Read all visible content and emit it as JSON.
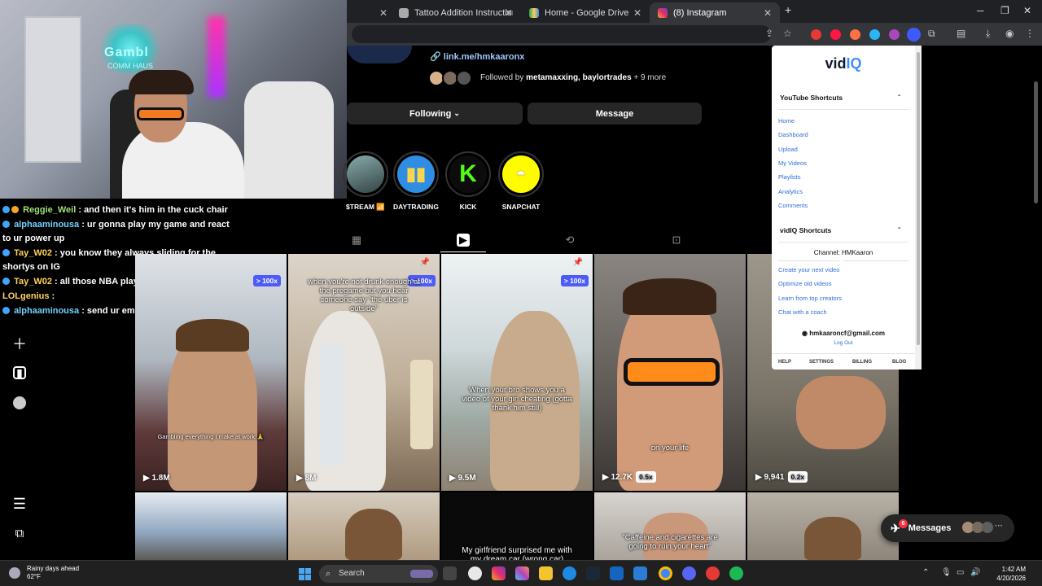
{
  "browser": {
    "tabs": [
      {
        "title": "Tattoo Addition Instructions",
        "active": false
      },
      {
        "title": "Home - Google Drive",
        "active": false
      },
      {
        "title": "(8) Instagram",
        "active": true
      }
    ],
    "new_tab_symbol": "+"
  },
  "webcam": {
    "sign_line1": "Gambl",
    "sign_line2": "COMM HAUS"
  },
  "chat": [
    {
      "user": "Reggie_Weil",
      "message": ": and then it's him in the cuck chair",
      "cont": ""
    },
    {
      "user": "alphaaminousa",
      "message": ": ur gonna play my game and react",
      "cont": "to ur power up"
    },
    {
      "user": "Tay_W02",
      "message": ": you know they always sliding for the",
      "cont": "shortys on IG"
    },
    {
      "user": "Tay_W02",
      "message": ": all those NBA players on that",
      "cont": ""
    },
    {
      "user": "LOLgenius",
      "message": ":",
      "cont": ""
    },
    {
      "user": "alphaaminousa",
      "message": ": send ur email",
      "cont": ""
    }
  ],
  "profile": {
    "link": "link.me/hmkaaronx",
    "followed_by_prefix": "Followed by ",
    "followed_by_names": "metamaxxing, baylortrades",
    "followed_by_more": " + 9 more",
    "following_button": "Following",
    "message_button": "Message"
  },
  "highlights": [
    {
      "label": "$TREAM 📶",
      "color": "#5a6a7a",
      "glyph": ""
    },
    {
      "label": "DAYTRADING",
      "color": "#2f8de4",
      "glyph": "📊"
    },
    {
      "label": "KICK",
      "color": "#0c0c0c",
      "glyph": "K"
    },
    {
      "label": "SNAPCHAT",
      "color": "#fffc00",
      "glyph": "👻"
    }
  ],
  "reels": [
    {
      "caption": "Gambling everything I make at work 🙏",
      "views": "1.8M",
      "multiplier": "> 100x",
      "bg": "#c9cdd3"
    },
    {
      "caption": "when you're not drunk enough at the pregame but you hear someone say \"the uber is outside\"",
      "views": "8M",
      "multiplier": "> 100x",
      "bg": "#b9a48f"
    },
    {
      "caption": "When your bro shows you a video of your girl cheating (gotta thank him still)",
      "views": "9.5M",
      "multiplier": "> 100x",
      "bg": "#c2ccd0"
    },
    {
      "caption": "on your life",
      "views": "12.7K",
      "multiplier": "0.5x",
      "bg": "#6e6a66"
    },
    {
      "caption": "",
      "views": "9,941",
      "multiplier": "0.2x",
      "bg": "#8c8a80"
    }
  ],
  "reels_row2": [
    {
      "caption": "",
      "bg": "#9ab0c8"
    },
    {
      "caption": "",
      "bg": "#b4a28e"
    },
    {
      "caption": "My girlfriend surprised me with my dream car (wrong car)",
      "bg": "#0a0a0a"
    },
    {
      "caption": "\"Caffeine and cigarettes are going to ruin your heart\"",
      "bg": "#c8c4c0"
    },
    {
      "caption": "",
      "bg": "#a29c94"
    }
  ],
  "vidiq": {
    "logo_a": "vid",
    "logo_b": "IQ",
    "youtube_section": "YouTube Shortcuts",
    "youtube_links": [
      "Home",
      "Dashboard",
      "Upload",
      "My Videos",
      "Playlists",
      "Analytics",
      "Comments"
    ],
    "vidiq_section": "vidIQ Shortcuts",
    "channel": "Channel: HMKaaron",
    "vidiq_links": [
      "Create your next video",
      "Optimize old videos",
      "Learn from top creators",
      "Chat with a coach"
    ],
    "email": "hmkaaroncf@gmail.com",
    "logout": "Log Out",
    "footer": [
      "HELP",
      "SETTINGS",
      "BILLING",
      "BLOG"
    ]
  },
  "messages": {
    "label": "Messages",
    "count": "6"
  },
  "taskbar": {
    "weather_line1": "Rainy days ahead",
    "weather_line2": "62°F",
    "search": "Search",
    "time": "1:42 AM",
    "date": "4/20/2026"
  },
  "icons": {
    "highlights_reel_tab": "reels-icon",
    "grid_tab": "grid-icon",
    "repost_tab": "repost-icon",
    "tagged_tab": "tagged-icon"
  }
}
